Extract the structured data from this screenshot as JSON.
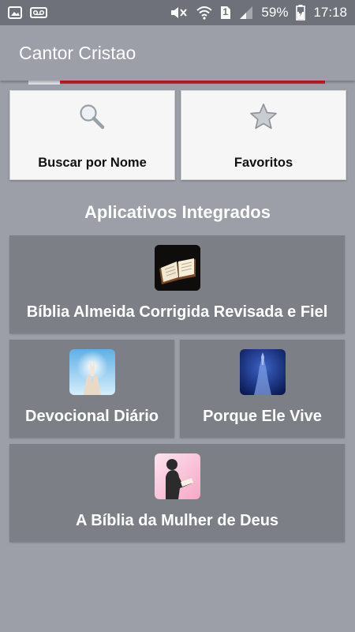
{
  "status_bar": {
    "battery_percent": "59%",
    "time": "17:18",
    "sim_slot": "1",
    "icons": [
      "gallery-icon",
      "voicemail-icon",
      "mute-icon",
      "wifi-icon",
      "sim-icon",
      "signal-icon",
      "battery-charging-icon"
    ]
  },
  "app_bar": {
    "title": "Cantor Cristao"
  },
  "top_cards": [
    {
      "label": "Buscar por Nome",
      "icon": "search-icon"
    },
    {
      "label": "Favoritos",
      "icon": "star-icon"
    }
  ],
  "section_title": "Aplicativos Integrados",
  "apps": [
    {
      "label": "Bíblia Almeida Corrigida Revisada e Fiel",
      "icon": "open-bible-icon"
    },
    {
      "label": "Devocional Diário",
      "icon": "praying-hands-icon"
    },
    {
      "label": "Porque Ele Vive",
      "icon": "praying-figure-icon"
    },
    {
      "label": "A Bíblia da Mulher de Deus",
      "icon": "woman-reading-icon"
    }
  ],
  "colors": {
    "background": "#9c9ea8",
    "status_bar": "#6f717a",
    "tile": "#7d7f87",
    "card": "#f6f6f6",
    "banner_red": "#d8192a"
  }
}
